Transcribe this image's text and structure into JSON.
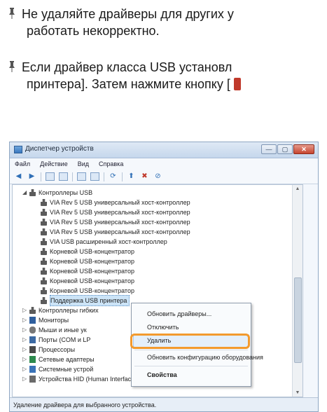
{
  "notes": [
    {
      "line1": "Не удаляйте драйверы для других у",
      "line2": "работать некорректно."
    },
    {
      "line1": "Если драйвер класса USB установл",
      "line2": "принтера]. Затем нажмите кнопку ["
    }
  ],
  "window": {
    "title": "Диспетчер устройств",
    "controls": [
      "—",
      "▢",
      "✕"
    ],
    "menu": [
      "Файл",
      "Действие",
      "Вид",
      "Справка"
    ],
    "status": "Удаление драйвера для выбранного устройства."
  },
  "tree": {
    "usb_group": "Контроллеры USB",
    "usb_items": [
      "VIA Rev 5 USB универсальный хост-контроллер",
      "VIA Rev 5 USB универсальный хост-контроллер",
      "VIA Rev 5 USB универсальный хост-контроллер",
      "VIA Rev 5 USB универсальный хост-контроллер",
      "VIA USB расширенный хост-контроллер",
      "Корневой USB-концентратор",
      "Корневой USB-концентратор",
      "Корневой USB-концентратор",
      "Корневой USB-концентратор",
      "Корневой USB-концентратор"
    ],
    "selected_item": "Поддержка USB принтера",
    "other_groups": [
      "Контроллеры гибких",
      "Мониторы",
      "Мыши и иные ук",
      "Порты (COM и LP",
      "Процессоры",
      "Сетевые адаптеры",
      "Системные устрой",
      "Устройства HID (Human Interface Devices)"
    ]
  },
  "context_menu": {
    "items": [
      "Обновить драйверы...",
      "Отключить",
      "Удалить",
      "Обновить конфигурацию оборудования",
      "Свойства"
    ]
  },
  "colors": {
    "highlight_ring": "#f39a2e",
    "selection": "#cce4f7"
  }
}
